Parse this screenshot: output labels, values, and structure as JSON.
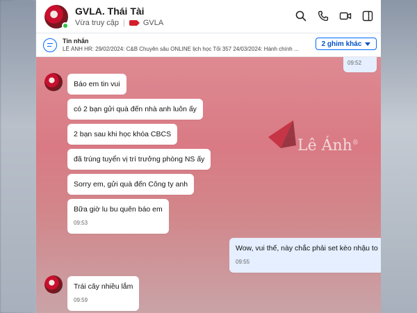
{
  "contact": {
    "name": "GVLA. Thái Tài",
    "status": "Vừa truy cập",
    "tag": "GVLA",
    "online": true
  },
  "header_icons": [
    "search-icon",
    "phone-icon",
    "video-icon",
    "sidebar-icon"
  ],
  "pinned": {
    "title": "Tin nhắn",
    "content": "LÊ ÁNH HR: 29/02/2024: C&B Chuyên sâu ONLINE lịch học Tối 357 24/03/2024: Hành chính ...",
    "more_button": "2 ghim khác"
  },
  "watermark": {
    "text": "Lê Ánh",
    "mark": "®"
  },
  "messages": [
    {
      "from": "me",
      "text": "",
      "time": "09:52"
    },
    {
      "from": "them",
      "text": "Báo em tin vui"
    },
    {
      "from": "them",
      "text": "có 2 bạn gửi quà đến nhà anh luôn ấy"
    },
    {
      "from": "them",
      "text": "2 bạn sau khi học khóa CBCS"
    },
    {
      "from": "them",
      "text": "đã trúng tuyển vị trí trưởng phòng NS ấy"
    },
    {
      "from": "them",
      "text": "Sorry em, gửi quà đến Công ty anh"
    },
    {
      "from": "them",
      "text": "Bữa giờ lu bu quên báo em",
      "time": "09:53"
    },
    {
      "from": "me",
      "text": "Wow, vui thế, này chắc phải set kèo nhậu to",
      "time": "09:55"
    },
    {
      "from": "them",
      "text": "Trái cây nhiều lắm",
      "time": "09:59"
    }
  ],
  "colors": {
    "accent": "#0068ff",
    "chat_bg": "#d97a84",
    "my_bubble": "#e5efff",
    "online": "#2fbf4a",
    "tag": "#d21f2b"
  }
}
